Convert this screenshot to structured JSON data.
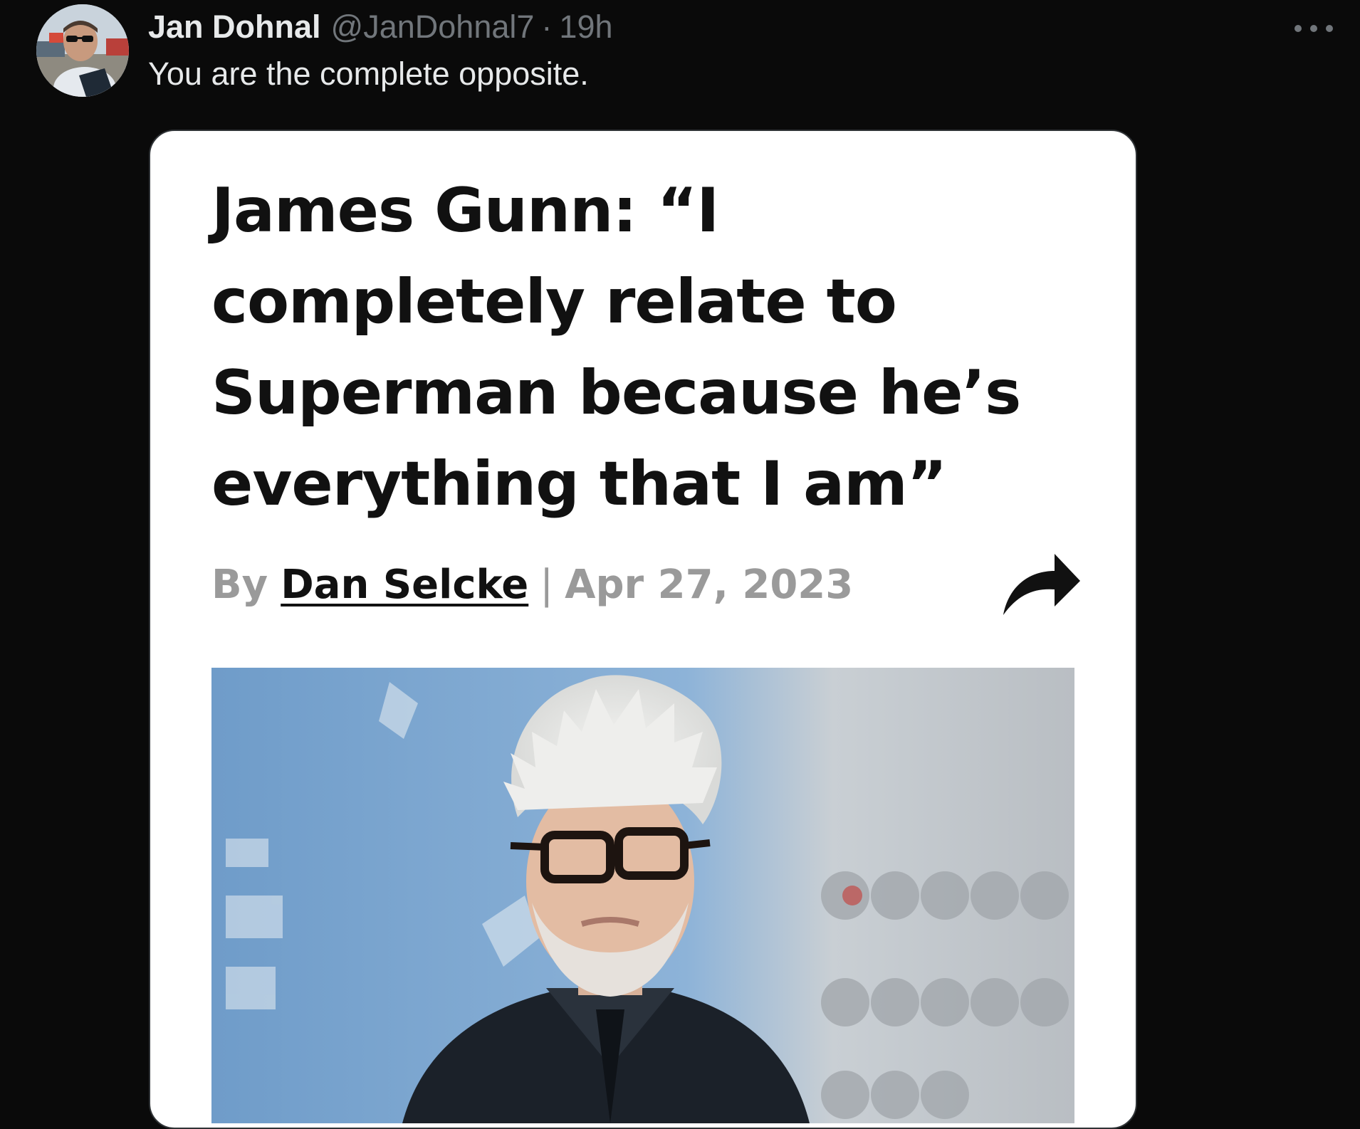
{
  "tweet": {
    "display_name": "Jan Dohnal",
    "handle": "@JanDohnal7",
    "separator": "·",
    "time": "19h",
    "text": "You are the complete opposite.",
    "more_icon": "more-horizontal-icon"
  },
  "article": {
    "title": "James Gunn: “I completely relate to Superman because he’s everything that I am”",
    "by_label": "By",
    "author": "Dan Selcke",
    "separator": "|",
    "date": "Apr 27, 2023",
    "share_icon": "share-arrow-icon"
  },
  "colors": {
    "background": "#0a0a0a",
    "primary_text": "#e7e9ea",
    "secondary_text": "#71767b",
    "card_background": "#ffffff",
    "title_text": "#111111",
    "byline_gray": "#9a9a9a"
  }
}
